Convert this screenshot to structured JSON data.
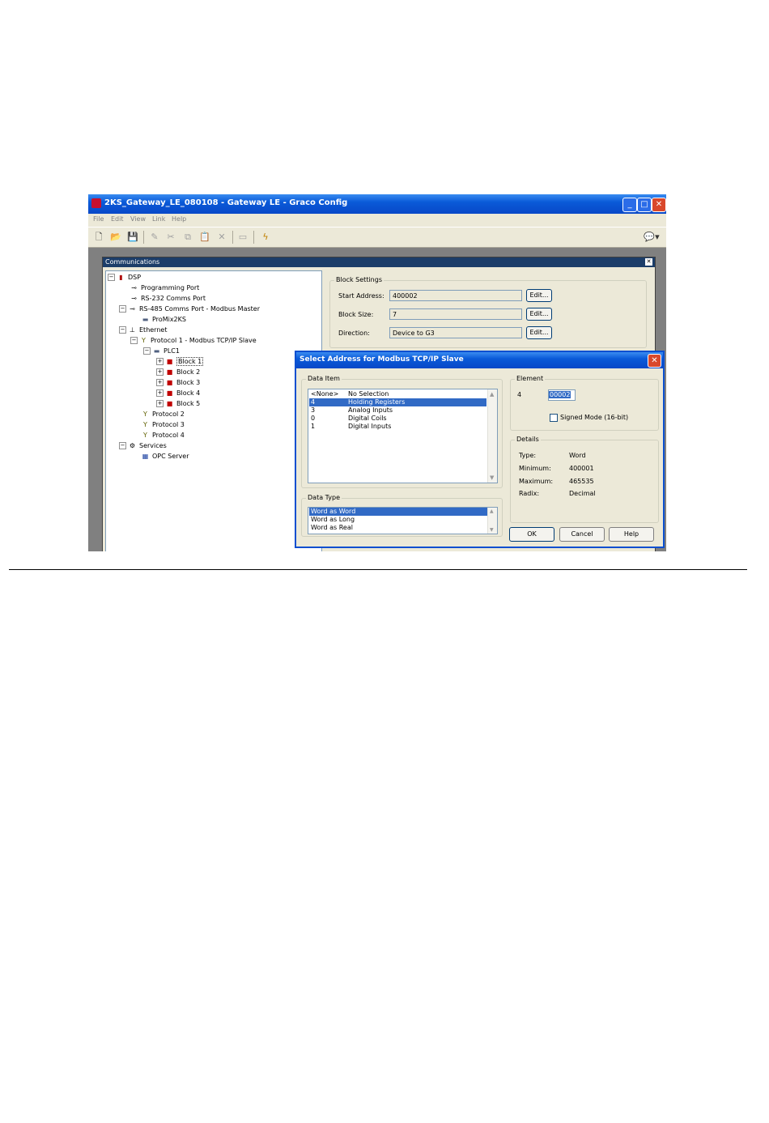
{
  "window": {
    "title": "2KS_Gateway_LE_080108 - Gateway LE - Graco Config"
  },
  "menu": [
    "File",
    "Edit",
    "View",
    "Link",
    "Help"
  ],
  "toolbar": {
    "icons": [
      "new-icon",
      "open-icon",
      "save-icon",
      "pen-icon",
      "cut-icon",
      "copy-icon",
      "paste-icon",
      "delete-icon",
      "frame-icon",
      "lightning-icon",
      "chat-icon"
    ]
  },
  "communications": {
    "title": "Communications",
    "tree": [
      {
        "label": "DSP"
      },
      {
        "label": "Programming Port"
      },
      {
        "label": "RS-232 Comms Port"
      },
      {
        "label": "RS-485 Comms Port - Modbus Master"
      },
      {
        "label": "ProMix2KS"
      },
      {
        "label": "Ethernet"
      },
      {
        "label": "Protocol 1 - Modbus TCP/IP Slave"
      },
      {
        "label": "PLC1"
      },
      {
        "label": "Block 1"
      },
      {
        "label": "Block 2"
      },
      {
        "label": "Block 3"
      },
      {
        "label": "Block 4"
      },
      {
        "label": "Block 5"
      },
      {
        "label": "Protocol 2"
      },
      {
        "label": "Protocol 3"
      },
      {
        "label": "Protocol 4"
      },
      {
        "label": "Services"
      },
      {
        "label": "OPC Server"
      }
    ]
  },
  "block_settings": {
    "title": "Block Settings",
    "start_address_label": "Start Address:",
    "start_address_value": "400002",
    "block_size_label": "Block Size:",
    "block_size_value": "7",
    "direction_label": "Direction:",
    "direction_value": "Device to G3",
    "edit_label": "Edit..."
  },
  "dialog": {
    "title": "Select Address for Modbus TCP/IP Slave",
    "data_item_label": "Data Item",
    "data_items": [
      {
        "code": "<None>",
        "name": "No Selection"
      },
      {
        "code": "4",
        "name": "Holding Registers"
      },
      {
        "code": "3",
        "name": "Analog Inputs"
      },
      {
        "code": "0",
        "name": "Digital Coils"
      },
      {
        "code": "1",
        "name": "Digital Inputs"
      }
    ],
    "data_type_label": "Data Type",
    "data_types": [
      "Word as Word",
      "Word as Long",
      "Word as Real"
    ],
    "element_label": "Element",
    "element_prefix": "4",
    "element_value": "00002",
    "signed_mode_label": "Signed Mode (16-bit)",
    "details_label": "Details",
    "details": [
      {
        "key": "Type:",
        "value": "Word"
      },
      {
        "key": "Minimum:",
        "value": "400001"
      },
      {
        "key": "Maximum:",
        "value": "465535"
      },
      {
        "key": "Radix:",
        "value": "Decimal"
      }
    ],
    "ok_label": "OK",
    "cancel_label": "Cancel",
    "help_label": "Help"
  }
}
